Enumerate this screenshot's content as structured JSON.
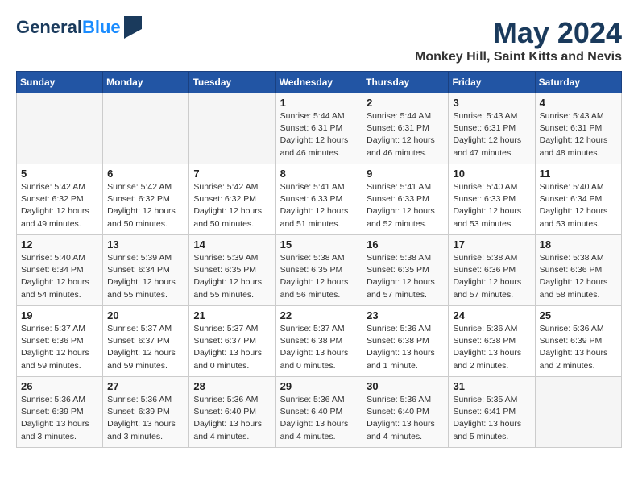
{
  "logo": {
    "general": "General",
    "blue": "Blue"
  },
  "header": {
    "month": "May 2024",
    "location": "Monkey Hill, Saint Kitts and Nevis"
  },
  "weekdays": [
    "Sunday",
    "Monday",
    "Tuesday",
    "Wednesday",
    "Thursday",
    "Friday",
    "Saturday"
  ],
  "weeks": [
    [
      {
        "day": "",
        "info": ""
      },
      {
        "day": "",
        "info": ""
      },
      {
        "day": "",
        "info": ""
      },
      {
        "day": "1",
        "info": "Sunrise: 5:44 AM\nSunset: 6:31 PM\nDaylight: 12 hours\nand 46 minutes."
      },
      {
        "day": "2",
        "info": "Sunrise: 5:44 AM\nSunset: 6:31 PM\nDaylight: 12 hours\nand 46 minutes."
      },
      {
        "day": "3",
        "info": "Sunrise: 5:43 AM\nSunset: 6:31 PM\nDaylight: 12 hours\nand 47 minutes."
      },
      {
        "day": "4",
        "info": "Sunrise: 5:43 AM\nSunset: 6:31 PM\nDaylight: 12 hours\nand 48 minutes."
      }
    ],
    [
      {
        "day": "5",
        "info": "Sunrise: 5:42 AM\nSunset: 6:32 PM\nDaylight: 12 hours\nand 49 minutes."
      },
      {
        "day": "6",
        "info": "Sunrise: 5:42 AM\nSunset: 6:32 PM\nDaylight: 12 hours\nand 50 minutes."
      },
      {
        "day": "7",
        "info": "Sunrise: 5:42 AM\nSunset: 6:32 PM\nDaylight: 12 hours\nand 50 minutes."
      },
      {
        "day": "8",
        "info": "Sunrise: 5:41 AM\nSunset: 6:33 PM\nDaylight: 12 hours\nand 51 minutes."
      },
      {
        "day": "9",
        "info": "Sunrise: 5:41 AM\nSunset: 6:33 PM\nDaylight: 12 hours\nand 52 minutes."
      },
      {
        "day": "10",
        "info": "Sunrise: 5:40 AM\nSunset: 6:33 PM\nDaylight: 12 hours\nand 53 minutes."
      },
      {
        "day": "11",
        "info": "Sunrise: 5:40 AM\nSunset: 6:34 PM\nDaylight: 12 hours\nand 53 minutes."
      }
    ],
    [
      {
        "day": "12",
        "info": "Sunrise: 5:40 AM\nSunset: 6:34 PM\nDaylight: 12 hours\nand 54 minutes."
      },
      {
        "day": "13",
        "info": "Sunrise: 5:39 AM\nSunset: 6:34 PM\nDaylight: 12 hours\nand 55 minutes."
      },
      {
        "day": "14",
        "info": "Sunrise: 5:39 AM\nSunset: 6:35 PM\nDaylight: 12 hours\nand 55 minutes."
      },
      {
        "day": "15",
        "info": "Sunrise: 5:38 AM\nSunset: 6:35 PM\nDaylight: 12 hours\nand 56 minutes."
      },
      {
        "day": "16",
        "info": "Sunrise: 5:38 AM\nSunset: 6:35 PM\nDaylight: 12 hours\nand 57 minutes."
      },
      {
        "day": "17",
        "info": "Sunrise: 5:38 AM\nSunset: 6:36 PM\nDaylight: 12 hours\nand 57 minutes."
      },
      {
        "day": "18",
        "info": "Sunrise: 5:38 AM\nSunset: 6:36 PM\nDaylight: 12 hours\nand 58 minutes."
      }
    ],
    [
      {
        "day": "19",
        "info": "Sunrise: 5:37 AM\nSunset: 6:36 PM\nDaylight: 12 hours\nand 59 minutes."
      },
      {
        "day": "20",
        "info": "Sunrise: 5:37 AM\nSunset: 6:37 PM\nDaylight: 12 hours\nand 59 minutes."
      },
      {
        "day": "21",
        "info": "Sunrise: 5:37 AM\nSunset: 6:37 PM\nDaylight: 13 hours\nand 0 minutes."
      },
      {
        "day": "22",
        "info": "Sunrise: 5:37 AM\nSunset: 6:38 PM\nDaylight: 13 hours\nand 0 minutes."
      },
      {
        "day": "23",
        "info": "Sunrise: 5:36 AM\nSunset: 6:38 PM\nDaylight: 13 hours\nand 1 minute."
      },
      {
        "day": "24",
        "info": "Sunrise: 5:36 AM\nSunset: 6:38 PM\nDaylight: 13 hours\nand 2 minutes."
      },
      {
        "day": "25",
        "info": "Sunrise: 5:36 AM\nSunset: 6:39 PM\nDaylight: 13 hours\nand 2 minutes."
      }
    ],
    [
      {
        "day": "26",
        "info": "Sunrise: 5:36 AM\nSunset: 6:39 PM\nDaylight: 13 hours\nand 3 minutes."
      },
      {
        "day": "27",
        "info": "Sunrise: 5:36 AM\nSunset: 6:39 PM\nDaylight: 13 hours\nand 3 minutes."
      },
      {
        "day": "28",
        "info": "Sunrise: 5:36 AM\nSunset: 6:40 PM\nDaylight: 13 hours\nand 4 minutes."
      },
      {
        "day": "29",
        "info": "Sunrise: 5:36 AM\nSunset: 6:40 PM\nDaylight: 13 hours\nand 4 minutes."
      },
      {
        "day": "30",
        "info": "Sunrise: 5:36 AM\nSunset: 6:40 PM\nDaylight: 13 hours\nand 4 minutes."
      },
      {
        "day": "31",
        "info": "Sunrise: 5:35 AM\nSunset: 6:41 PM\nDaylight: 13 hours\nand 5 minutes."
      },
      {
        "day": "",
        "info": ""
      }
    ]
  ]
}
